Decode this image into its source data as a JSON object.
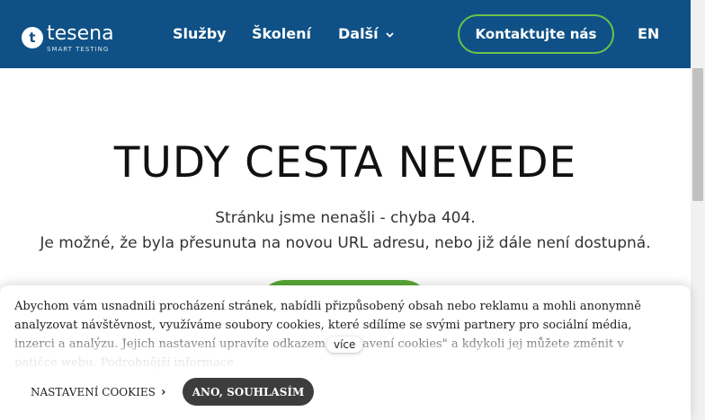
{
  "header": {
    "logo": {
      "mark": "t",
      "name": "tesena",
      "tagline": "SMART TESTING"
    },
    "nav": [
      {
        "label": "Služby"
      },
      {
        "label": "Školení"
      },
      {
        "label": "Další"
      }
    ],
    "dropdown_icon": "chevron-down-icon",
    "contact_label": "Kontaktujte nás",
    "language_label": "EN",
    "colors": {
      "background": "#0f5186",
      "accent": "#6cc24a"
    }
  },
  "main": {
    "title": "TUDY CESTA NEVEDE",
    "subtitle_line1": "Stránku jsme nenašli - chyba 404.",
    "subtitle_line2": "Je možné, že byla přesunuta na novou URL adresu, nebo již dále není dostupná.",
    "button_color": "#59a936"
  },
  "cookie_banner": {
    "text": "Abychom vám usnadnili procházení stránek, nabídli přizpůsobený obsah nebo reklamu a mohli anonymně analyzovat návštěvnost, využíváme soubory cookies, které sdílíme se svými partnery pro sociální média, inzerci a analýzu. Jejich nastavení upravíte odkazem \"Nastavení cookies\" a kdykoli jej můžete změnit v patičce webu. Podrobnější informace",
    "more_label": "více",
    "settings_label": "NASTAVENÍ COOKIES",
    "settings_icon": "chevron-right-icon",
    "accept_label": "ANO, SOUHLASÍM"
  }
}
